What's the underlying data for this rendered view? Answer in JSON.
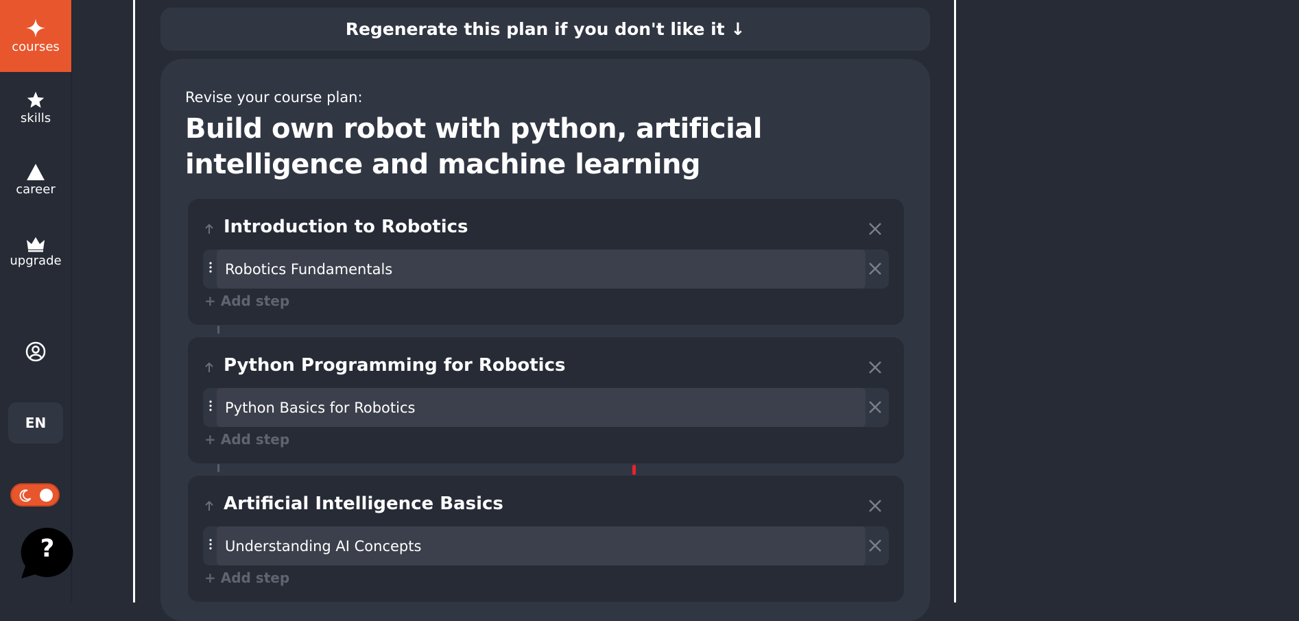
{
  "colors": {
    "accent": "#e8562d",
    "background": "#262b36",
    "panel": "#313643",
    "muted_text": "#5f6470"
  },
  "sidebar": {
    "items": [
      {
        "label": "courses",
        "icon": "sparkle-icon",
        "active": true
      },
      {
        "label": "skills",
        "icon": "star-icon",
        "active": false
      },
      {
        "label": "career",
        "icon": "triangle-icon",
        "active": false
      },
      {
        "label": "upgrade",
        "icon": "crown-icon",
        "active": false
      }
    ],
    "profile_icon": "user-circle-icon",
    "language": "EN",
    "theme_toggle_icon": "moon-icon",
    "help_label": "?"
  },
  "main": {
    "regenerate_label": "Regenerate this plan if you don't like it ↓",
    "eyebrow": "Revise your course plan:",
    "title": "Build own robot with python, artificial intelligence and machine learning",
    "modules": [
      {
        "title": "Introduction to Robotics",
        "steps": [
          "Robotics Fundamentals"
        ],
        "add_step_label": "+ Add step"
      },
      {
        "title": "Python Programming for Robotics",
        "steps": [
          "Python Basics for Robotics"
        ],
        "add_step_label": "+ Add step"
      },
      {
        "title": "Artificial Intelligence Basics",
        "steps": [
          "Understanding AI Concepts"
        ],
        "add_step_label": "+ Add step"
      }
    ]
  }
}
